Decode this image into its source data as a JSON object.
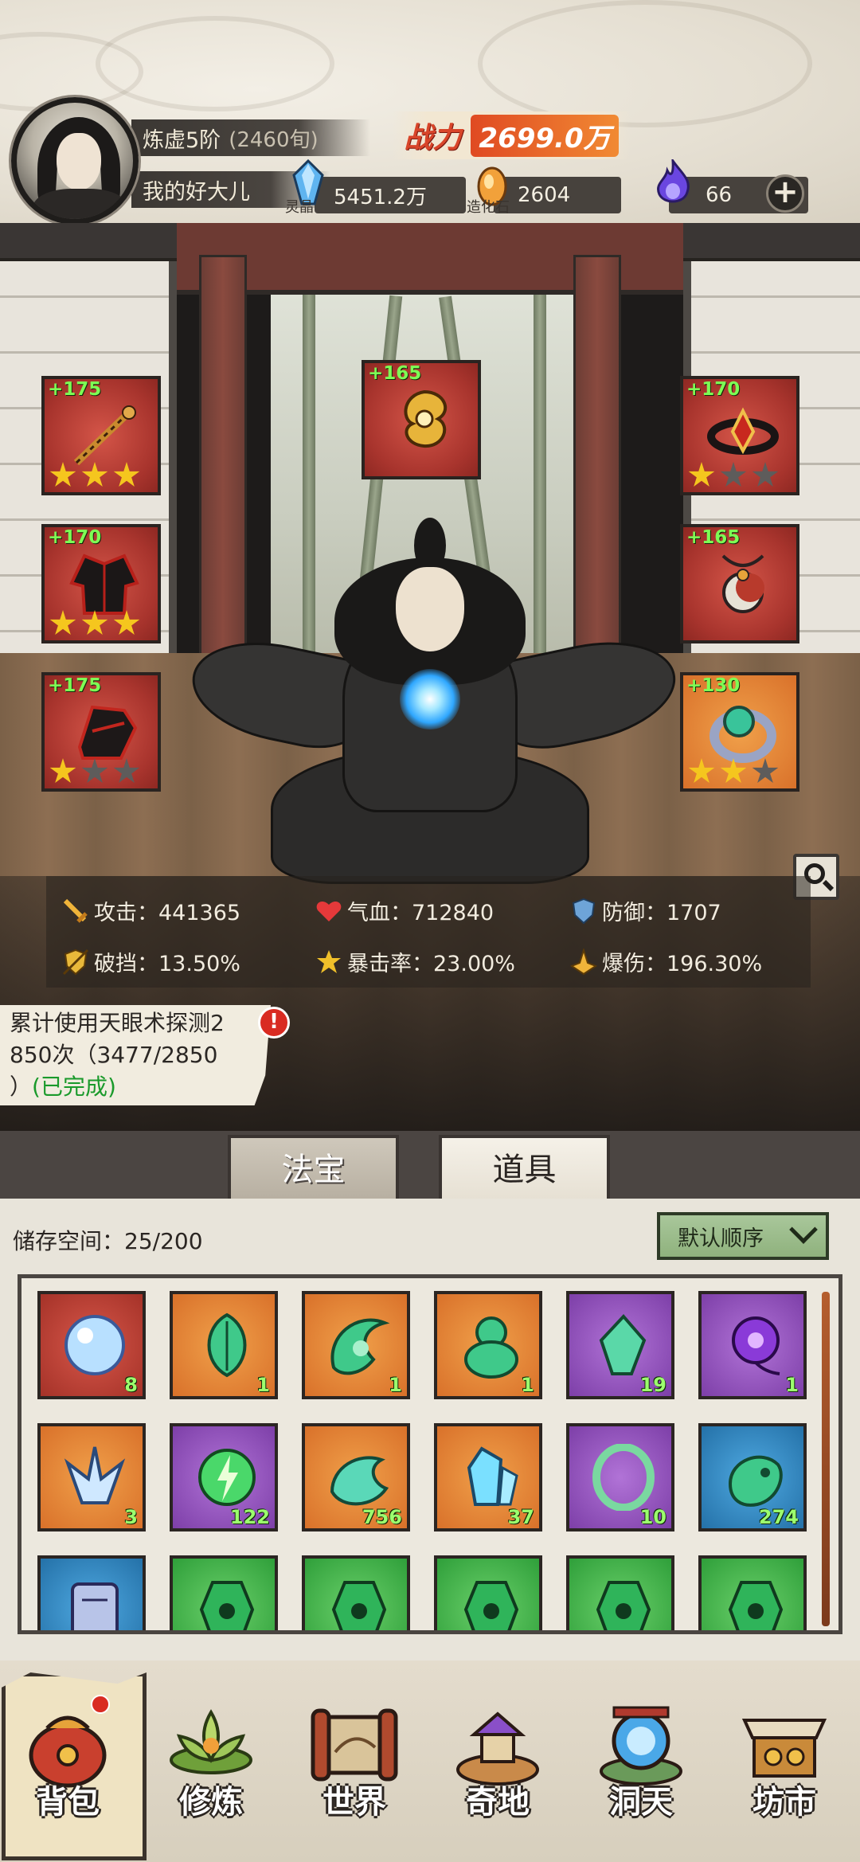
{
  "player": {
    "realm": "炼虚5阶",
    "realm_sub": "(2460旬)",
    "nickname": "我的好大儿",
    "power_label": "战力",
    "power_value": "2699.0万"
  },
  "resources": [
    {
      "name": "灵晶",
      "value": "5451.2万",
      "icon": "blue-crystal-icon",
      "color": "#58a8e8"
    },
    {
      "name": "造化石",
      "value": "2604",
      "icon": "orange-stone-icon",
      "color": "#f0a63a"
    },
    {
      "name": "",
      "value": "66",
      "icon": "purple-flame-icon",
      "color": "#7a4de0"
    }
  ],
  "equipment": [
    {
      "slot": "weapon",
      "bonus": "+175",
      "stars": 3
    },
    {
      "slot": "top",
      "bonus": "+165",
      "stars": 0
    },
    {
      "slot": "headband",
      "bonus": "+170",
      "stars": 1
    },
    {
      "slot": "armor",
      "bonus": "+170",
      "stars": 3
    },
    {
      "slot": "pendant",
      "bonus": "+165",
      "stars": 0
    },
    {
      "slot": "boots",
      "bonus": "+175",
      "stars": 1
    },
    {
      "slot": "ring",
      "bonus": "+130",
      "stars": 2
    }
  ],
  "stats": {
    "attack": "攻击：441365",
    "hp": "气血：712840",
    "defense": "防御：1707",
    "pierce": "破挡：13.50%",
    "crit_rate": "暴击率：23.00%",
    "crit_dmg": "爆伤：196.30%"
  },
  "quest": {
    "line1": "累计使用天眼术探测2",
    "line2": "850次（3477/2850",
    "line3": "）",
    "status": "(已完成)"
  },
  "tabs": {
    "fabao": "法宝",
    "daoju": "道具"
  },
  "inventory": {
    "storage_label": "储存空间：",
    "storage_value": "25/200",
    "sort_label": "默认顺序",
    "items": [
      {
        "color": "red",
        "count": "8",
        "icon": "bubble-orb-icon"
      },
      {
        "color": "orange",
        "count": "1",
        "icon": "jade-leaf-icon"
      },
      {
        "color": "orange",
        "count": "1",
        "icon": "jade-swirl-icon"
      },
      {
        "color": "orange",
        "count": "1",
        "icon": "jade-gourd-icon"
      },
      {
        "color": "purple",
        "count": "19",
        "icon": "green-crystal-icon"
      },
      {
        "color": "purple",
        "count": "1",
        "icon": "purple-flower-icon"
      },
      {
        "color": "orange",
        "count": "3",
        "icon": "ice-crystal-icon"
      },
      {
        "color": "purple",
        "count": "122",
        "icon": "lightning-orb-icon"
      },
      {
        "color": "orange",
        "count": "756",
        "icon": "jade-cloud-icon"
      },
      {
        "color": "orange",
        "count": "37",
        "icon": "spirit-crystal-icon"
      },
      {
        "color": "purple",
        "count": "10",
        "icon": "jade-ring-icon"
      },
      {
        "color": "blue",
        "count": "274",
        "icon": "jade-beast-icon"
      },
      {
        "color": "blue",
        "count": "",
        "icon": "scroll-icon"
      },
      {
        "color": "green",
        "count": "",
        "icon": "rune-gem-icon"
      },
      {
        "color": "green",
        "count": "",
        "icon": "rune-gem-icon"
      },
      {
        "color": "green",
        "count": "",
        "icon": "rune-gem-icon"
      },
      {
        "color": "green",
        "count": "",
        "icon": "rune-gem-icon"
      },
      {
        "color": "green",
        "count": "",
        "icon": "rune-gem-icon"
      }
    ]
  },
  "nav": [
    {
      "label": "背包",
      "icon": "bag-icon"
    },
    {
      "label": "修炼",
      "icon": "lotus-icon"
    },
    {
      "label": "世界",
      "icon": "scroll-map-icon"
    },
    {
      "label": "奇地",
      "icon": "pavilion-icon"
    },
    {
      "label": "洞天",
      "icon": "portal-icon"
    },
    {
      "label": "坊市",
      "icon": "market-icon"
    }
  ]
}
